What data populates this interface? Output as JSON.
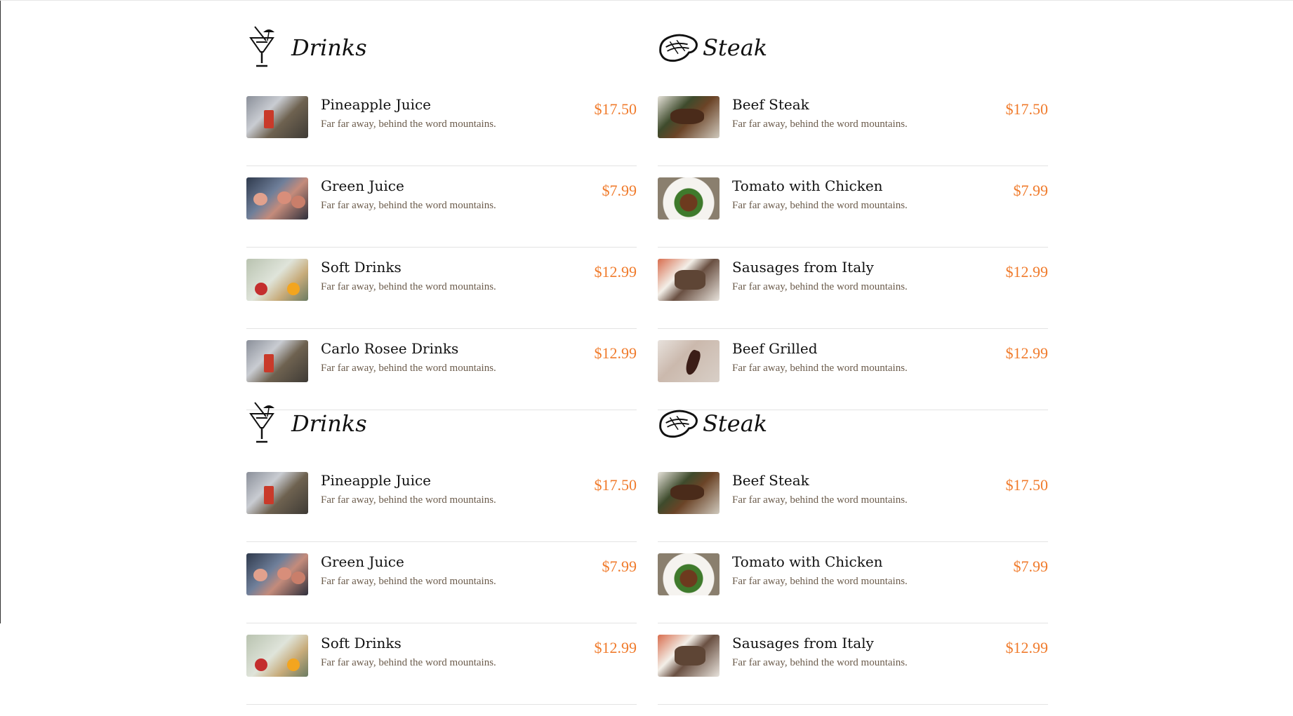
{
  "sections": [
    {
      "title": "Drinks",
      "icon": "cocktail-icon",
      "items": [
        {
          "name": "Pineapple Juice",
          "desc": "Far far away, behind the word mountains.",
          "price": "$17.50",
          "thumb": "t-drinks1"
        },
        {
          "name": "Green Juice",
          "desc": "Far far away, behind the word mountains.",
          "price": "$7.99",
          "thumb": "t-drinks2"
        },
        {
          "name": "Soft Drinks",
          "desc": "Far far away, behind the word mountains.",
          "price": "$12.99",
          "thumb": "t-drinks3"
        },
        {
          "name": "Carlo Rosee Drinks",
          "desc": "Far far away, behind the word mountains.",
          "price": "$12.99",
          "thumb": "t-drinks1"
        }
      ]
    },
    {
      "title": "Steak",
      "icon": "steak-icon",
      "items": [
        {
          "name": "Beef Steak",
          "desc": "Far far away, behind the word mountains.",
          "price": "$17.50",
          "thumb": "t-steak1"
        },
        {
          "name": "Tomato with Chicken",
          "desc": "Far far away, behind the word mountains.",
          "price": "$7.99",
          "thumb": "t-steak2"
        },
        {
          "name": "Sausages from Italy",
          "desc": "Far far away, behind the word mountains.",
          "price": "$12.99",
          "thumb": "t-steak3"
        },
        {
          "name": "Beef Grilled",
          "desc": "Far far away, behind the word mountains.",
          "price": "$12.99",
          "thumb": "t-steak4"
        }
      ]
    },
    {
      "title": "Drinks",
      "icon": "cocktail-icon",
      "items": [
        {
          "name": "Pineapple Juice",
          "desc": "Far far away, behind the word mountains.",
          "price": "$17.50",
          "thumb": "t-drinks1"
        },
        {
          "name": "Green Juice",
          "desc": "Far far away, behind the word mountains.",
          "price": "$7.99",
          "thumb": "t-drinks2"
        },
        {
          "name": "Soft Drinks",
          "desc": "Far far away, behind the word mountains.",
          "price": "$12.99",
          "thumb": "t-drinks3"
        }
      ]
    },
    {
      "title": "Steak",
      "icon": "steak-icon",
      "items": [
        {
          "name": "Beef Steak",
          "desc": "Far far away, behind the word mountains.",
          "price": "$17.50",
          "thumb": "t-steak1"
        },
        {
          "name": "Tomato with Chicken",
          "desc": "Far far away, behind the word mountains.",
          "price": "$7.99",
          "thumb": "t-steak2"
        },
        {
          "name": "Sausages from Italy",
          "desc": "Far far away, behind the word mountains.",
          "price": "$12.99",
          "thumb": "t-steak3"
        }
      ]
    }
  ],
  "colors": {
    "price": "#f07b2c",
    "divider": "#e3e3e3"
  }
}
